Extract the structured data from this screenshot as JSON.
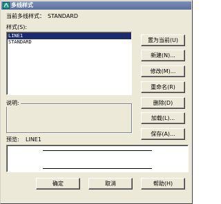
{
  "window": {
    "title": "多线样式",
    "current_style_label": "当前多线样式：",
    "current_style_value": "STANDARD"
  },
  "styles": {
    "label": "样式(S):",
    "items": [
      "LINE1",
      "STANDARD"
    ],
    "selected": "LINE1"
  },
  "buttons": {
    "set_current": "置为当前(U)",
    "new": "新建(N)...",
    "modify": "修改(M)...",
    "rename": "重命名(R)",
    "delete": "删除(D)",
    "load": "加载(L)...",
    "save": "保存(A)...",
    "ok": "确定",
    "cancel": "取消",
    "help": "帮助(H)"
  },
  "description": {
    "label": "说明:"
  },
  "preview": {
    "label": "预览:",
    "value": "LINE1"
  },
  "colors": {
    "selection": "#1c2a6e",
    "titlebar": "#5a6f9e",
    "dialog": "#ece9d8"
  }
}
